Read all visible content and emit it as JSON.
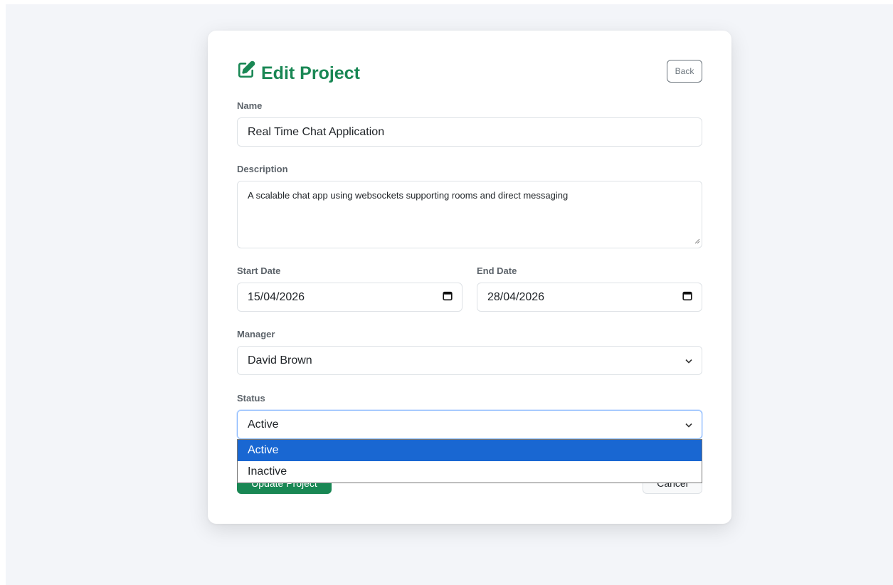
{
  "form": {
    "title": "Edit Project",
    "back_label": "Back",
    "name": {
      "label": "Name",
      "value": "Real Time Chat Application"
    },
    "description": {
      "label": "Description",
      "value": "A scalable chat app using websockets supporting rooms and direct messaging"
    },
    "start_date": {
      "label": "Start Date",
      "value": "15/04/2026"
    },
    "end_date": {
      "label": "End Date",
      "value": "28/04/2026"
    },
    "manager": {
      "label": "Manager",
      "value": "David Brown"
    },
    "status": {
      "label": "Status",
      "value": "Active",
      "options": [
        "Active",
        "Inactive"
      ]
    },
    "update_label": "Update Project",
    "cancel_label": "Cancel"
  },
  "colors": {
    "accent": "#198754",
    "dropdown_selected": "#1967d2",
    "page_background": "#f3f5f9"
  },
  "icons": [
    "edit-icon",
    "calendar-icon",
    "chevron-down-icon"
  ]
}
